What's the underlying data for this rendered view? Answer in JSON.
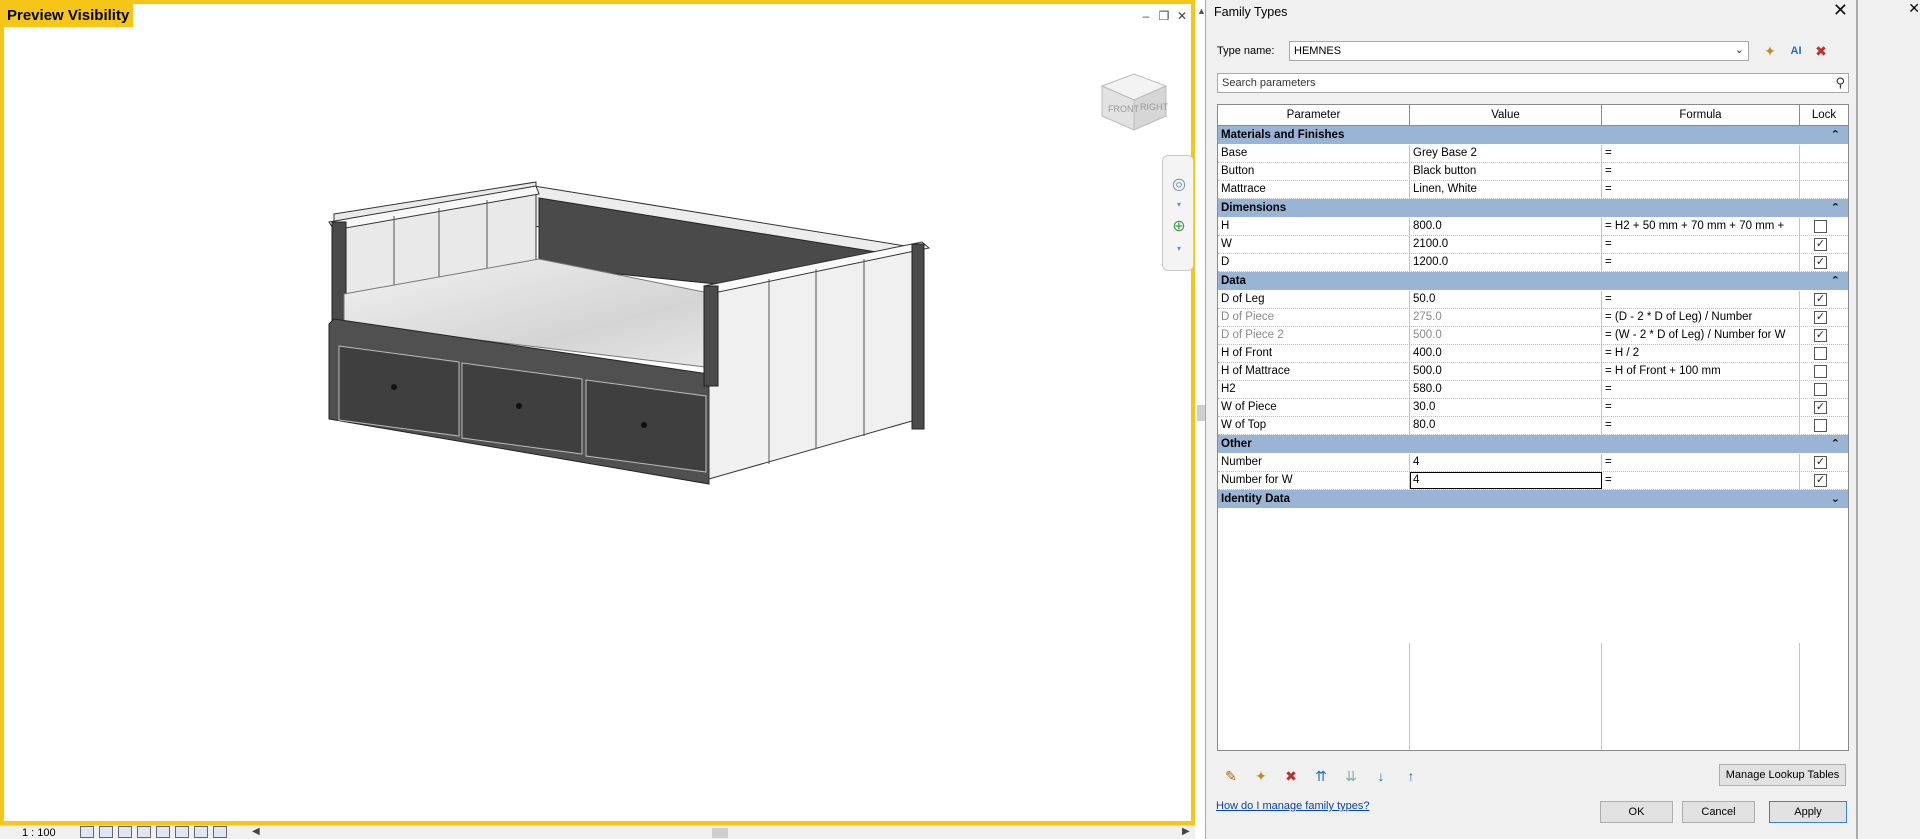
{
  "viewport": {
    "label": "Preview Visibility",
    "viewcube": {
      "front": "FRONT",
      "right": "RIGHT"
    },
    "scale": "1 : 100"
  },
  "dialog": {
    "title": "Family Types",
    "type_name_label": "Type name:",
    "type_name_value": "HEMNES",
    "search_placeholder": "Search parameters",
    "columns": [
      "Parameter",
      "Value",
      "Formula",
      "Lock"
    ],
    "groups": [
      {
        "name": "Materials and Finishes",
        "rows": [
          {
            "parameter": "Base",
            "value": "Grey Base 2",
            "formula": "="
          },
          {
            "parameter": "Button",
            "value": "Black button",
            "formula": "="
          },
          {
            "parameter": "Mattrace",
            "value": "Linen, White",
            "formula": "="
          }
        ]
      },
      {
        "name": "Dimensions",
        "rows": [
          {
            "parameter": "H",
            "value": "800.0",
            "formula": "= H2 + 50 mm + 70 mm + 70 mm +",
            "lock": false
          },
          {
            "parameter": "W",
            "value": "2100.0",
            "formula": "=",
            "lock": true
          },
          {
            "parameter": "D",
            "value": "1200.0",
            "formula": "=",
            "lock": true
          }
        ]
      },
      {
        "name": "Data",
        "rows": [
          {
            "parameter": "D of Leg",
            "value": "50.0",
            "formula": "=",
            "lock": true
          },
          {
            "parameter": "D of Piece",
            "value": "275.0",
            "formula": "= (D - 2 * D of Leg) / Number",
            "lock": true,
            "dim": true
          },
          {
            "parameter": "D of Piece 2",
            "value": "500.0",
            "formula": "= (W - 2 * D of Leg) / Number for W",
            "lock": true,
            "dim": true
          },
          {
            "parameter": "H of Front",
            "value": "400.0",
            "formula": "= H / 2",
            "lock": false
          },
          {
            "parameter": "H of Mattrace",
            "value": "500.0",
            "formula": "= H of Front + 100 mm",
            "lock": false
          },
          {
            "parameter": "H2",
            "value": "580.0",
            "formula": "=",
            "lock": false
          },
          {
            "parameter": "W of Piece",
            "value": "30.0",
            "formula": "=",
            "lock": true
          },
          {
            "parameter": "W of Top",
            "value": "80.0",
            "formula": "=",
            "lock": false
          }
        ]
      },
      {
        "name": "Other",
        "rows": [
          {
            "parameter": "Number",
            "value": "4",
            "formula": "=",
            "lock": true
          },
          {
            "parameter": "Number for W",
            "value": "4",
            "formula": "=",
            "lock": true,
            "editing": true
          }
        ]
      },
      {
        "name": "Identity Data",
        "collapsed": true,
        "rows": []
      }
    ],
    "manage_lookup_label": "Manage Lookup Tables",
    "help_link": "How do I manage family types?",
    "ok_label": "OK",
    "cancel_label": "Cancel",
    "apply_label": "Apply"
  }
}
